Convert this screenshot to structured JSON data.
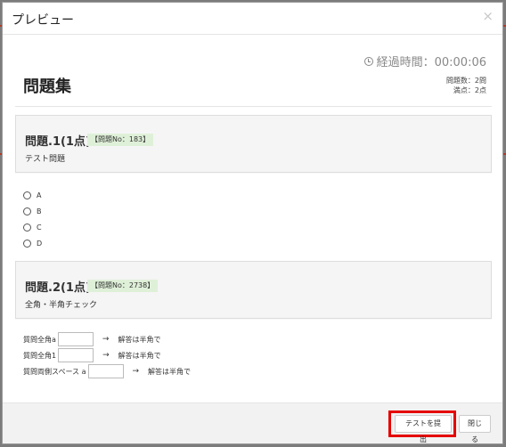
{
  "modal": {
    "title": "プレビュー",
    "close_glyph": "×"
  },
  "timer": {
    "label": "経過時間：00:00:06"
  },
  "page": {
    "title": "問題集"
  },
  "stats": {
    "count": "問題数：2問",
    "score": "満点：2点"
  },
  "questions": [
    {
      "heading": "問題.1(1点)",
      "badge": "【問題No：183】",
      "text": "テスト問題",
      "options": [
        "A",
        "B",
        "C",
        "D"
      ]
    },
    {
      "heading": "問題.2(1点)",
      "badge": "【問題No：2738】",
      "text": "全角・半角チェック",
      "rows": [
        {
          "prefix": "質問全角a",
          "hint": "解答は半角で"
        },
        {
          "prefix": "質問全角1",
          "hint": "解答は半角で"
        },
        {
          "prefix": "質問両側スペース a",
          "hint": "解答は半角で"
        }
      ],
      "arrow": "→"
    }
  ],
  "footer": {
    "submit_label": "テストを提出",
    "close_label": "閉じる"
  },
  "colors": {
    "highlight": "#e60000",
    "badge_bg": "#dff0d8"
  }
}
